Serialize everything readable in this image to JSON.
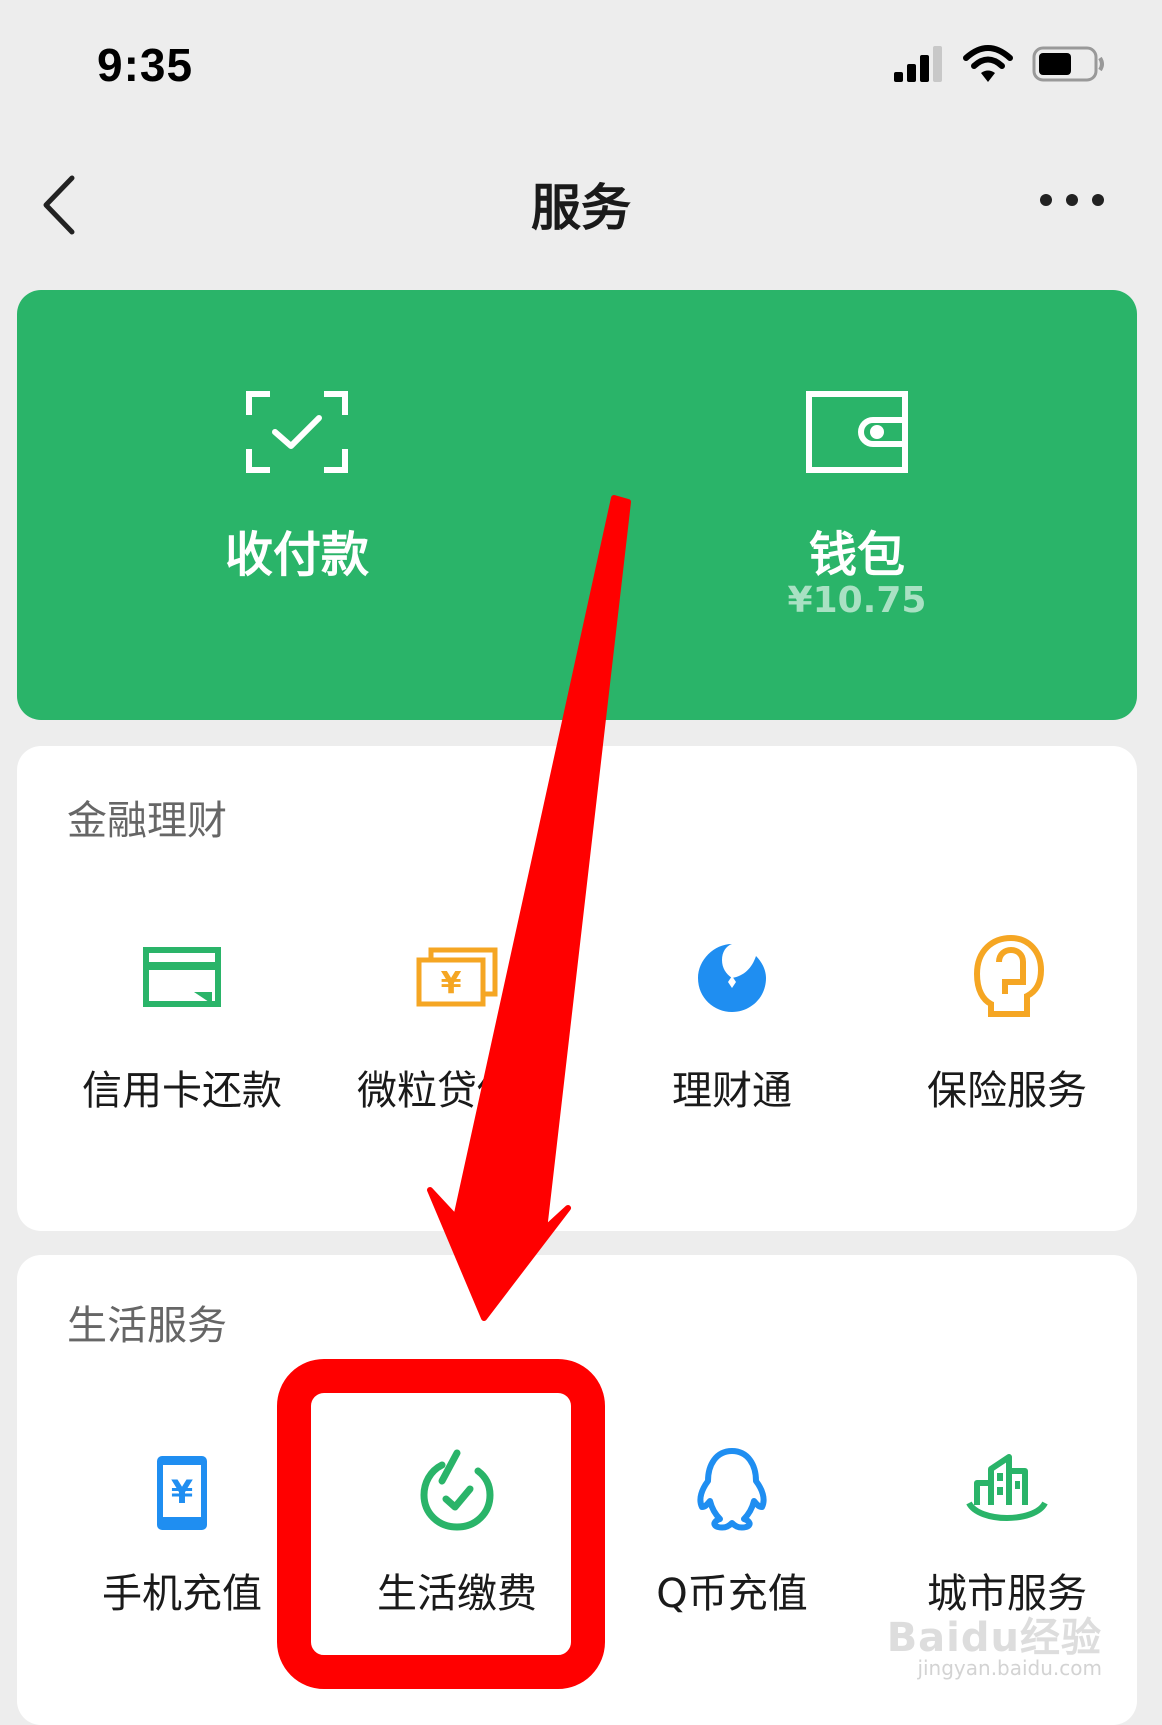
{
  "status": {
    "time": "9:35"
  },
  "nav": {
    "title": "服务"
  },
  "hero": {
    "pay": {
      "label": "收付款"
    },
    "wallet": {
      "label": "钱包",
      "balance": "¥10.75"
    }
  },
  "finance": {
    "title": "金融理财",
    "items": [
      {
        "label": "信用卡还款",
        "icon": "credit-card-icon"
      },
      {
        "label": "微粒贷借钱",
        "icon": "loan-icon"
      },
      {
        "label": "理财通",
        "icon": "wealth-icon"
      },
      {
        "label": "保险服务",
        "icon": "insurance-icon"
      }
    ]
  },
  "life": {
    "title": "生活服务",
    "items": [
      {
        "label": "手机充值",
        "icon": "phone-topup-icon"
      },
      {
        "label": "生活缴费",
        "icon": "utility-payment-icon"
      },
      {
        "label": "Q币充值",
        "icon": "qq-coin-icon"
      },
      {
        "label": "城市服务",
        "icon": "city-service-icon"
      }
    ]
  },
  "watermark": {
    "text": "Baidu经验",
    "url": "jingyan.baidu.com"
  },
  "colors": {
    "primary": "#2ab469",
    "annotation": "#ff0000",
    "orange": "#f5a623",
    "blue": "#1f8ef1"
  }
}
